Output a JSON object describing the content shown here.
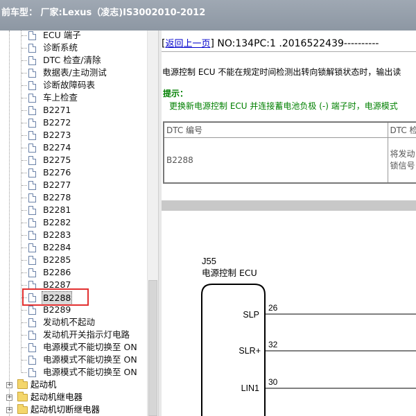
{
  "titlebar": {
    "text": "前车型： 厂家:Lexus（凌志)IS3002010-2012"
  },
  "tree": {
    "items": [
      {
        "label": "ECU 端子",
        "kind": "doc"
      },
      {
        "label": "诊断系统",
        "kind": "doc"
      },
      {
        "label": "DTC 检查/清除",
        "kind": "doc"
      },
      {
        "label": "数据表/主动测试",
        "kind": "doc"
      },
      {
        "label": "诊断故障码表",
        "kind": "doc"
      },
      {
        "label": "车上检查",
        "kind": "doc"
      },
      {
        "label": "B2271",
        "kind": "doc"
      },
      {
        "label": "B2272",
        "kind": "doc"
      },
      {
        "label": "B2273",
        "kind": "doc"
      },
      {
        "label": "B2274",
        "kind": "doc"
      },
      {
        "label": "B2275",
        "kind": "doc"
      },
      {
        "label": "B2276",
        "kind": "doc"
      },
      {
        "label": "B2277",
        "kind": "doc"
      },
      {
        "label": "B2278",
        "kind": "doc"
      },
      {
        "label": "B2281",
        "kind": "doc"
      },
      {
        "label": "B2282",
        "kind": "doc"
      },
      {
        "label": "B2283",
        "kind": "doc"
      },
      {
        "label": "B2284",
        "kind": "doc"
      },
      {
        "label": "B2285",
        "kind": "doc"
      },
      {
        "label": "B2286",
        "kind": "doc"
      },
      {
        "label": "B2287",
        "kind": "doc"
      },
      {
        "label": "B2288",
        "kind": "doc",
        "selected": true
      },
      {
        "label": "B2289",
        "kind": "doc"
      },
      {
        "label": "发动机不起动",
        "kind": "doc"
      },
      {
        "label": "发动机开关指示灯电路",
        "kind": "doc"
      },
      {
        "label": "电源模式不能切换至 ON",
        "kind": "doc"
      },
      {
        "label": "电源模式不能切换至 ON",
        "kind": "doc"
      },
      {
        "label": "电源模式不能切换至 ON",
        "kind": "doc"
      }
    ],
    "folders": [
      {
        "label": "起动机"
      },
      {
        "label": "起动机继电器"
      },
      {
        "label": "起动机切断继电器"
      }
    ]
  },
  "content": {
    "back_link": "返回上一页",
    "record": "NO:134PC:1 .2016522439----------",
    "description": "电源控制 ECU 不能在规定时间检测出转向锁解锁状态时，输出读",
    "hint_title": "提示：",
    "hint_text": "更换新电源控制 ECU 并连接蓄电池负极 (-) 端子时，电源模式",
    "table": {
      "headers": [
        "DTC 编号",
        "DTC 检"
      ],
      "row": [
        "B2288",
        "将发动\n锁信号"
      ]
    },
    "diagram": {
      "connector_id": "J55",
      "connector_name": "电源控制 ECU",
      "pins": [
        {
          "name": "SLP",
          "num": "26"
        },
        {
          "name": "SLR+",
          "num": "32"
        },
        {
          "name": "LIN1",
          "num": "30"
        }
      ]
    }
  }
}
